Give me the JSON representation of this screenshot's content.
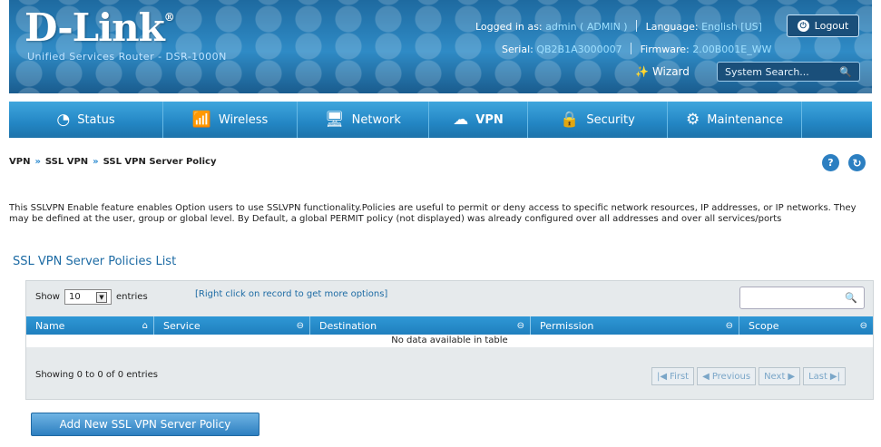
{
  "brand": {
    "logo": "D-Link",
    "logo_mark": "®",
    "subtitle": "Unified Services Router - DSR-1000N"
  },
  "header": {
    "logged_in_label": "Logged in as:",
    "logged_in_value": "admin ( ADMIN )",
    "language_label": "Language:",
    "language_value": "English [US]",
    "serial_label": "Serial:",
    "serial_value": "QB2B1A3000007",
    "firmware_label": "Firmware:",
    "firmware_value": "2.00B001E_WW",
    "logout_label": "Logout",
    "wizard_label": "Wizard",
    "search_placeholder": "System Search..."
  },
  "nav": {
    "items": [
      {
        "label": "Status",
        "icon": "dashboard-icon"
      },
      {
        "label": "Wireless",
        "icon": "wifi-icon"
      },
      {
        "label": "Network",
        "icon": "monitor-icon"
      },
      {
        "label": "VPN",
        "icon": "cloud-lock-icon",
        "active": true
      },
      {
        "label": "Security",
        "icon": "lock-icon"
      },
      {
        "label": "Maintenance",
        "icon": "gears-icon"
      }
    ]
  },
  "breadcrumb": [
    "VPN",
    "SSL VPN",
    "SSL VPN Server Policy"
  ],
  "description": "This SSLVPN Enable feature enables Option users to use SSLVPN functionality.Policies are useful to permit or deny access to specific network resources, IP addresses, or IP networks. They may be defined at the user, group or global level. By Default, a global PERMIT policy (not displayed) was already configured over all addresses and over all services/ports",
  "section_title": "SSL VPN Server Policies List",
  "table": {
    "show_label": "Show",
    "page_size": "10",
    "entries_label": "entries",
    "hint": "[Right click on record to get more options]",
    "columns": [
      "Name",
      "Service",
      "Destination",
      "Permission",
      "Scope"
    ],
    "empty_text": "No data available in table",
    "info": "Showing 0 to 0 of 0 entries",
    "pager": {
      "first": "First",
      "previous": "Previous",
      "next": "Next",
      "last": "Last"
    }
  },
  "add_button": "Add New SSL VPN Server Policy",
  "colors": {
    "brand_blue": "#2386c4",
    "header_dark": "#1e6aa0",
    "link_blue": "#1d6ba4"
  }
}
